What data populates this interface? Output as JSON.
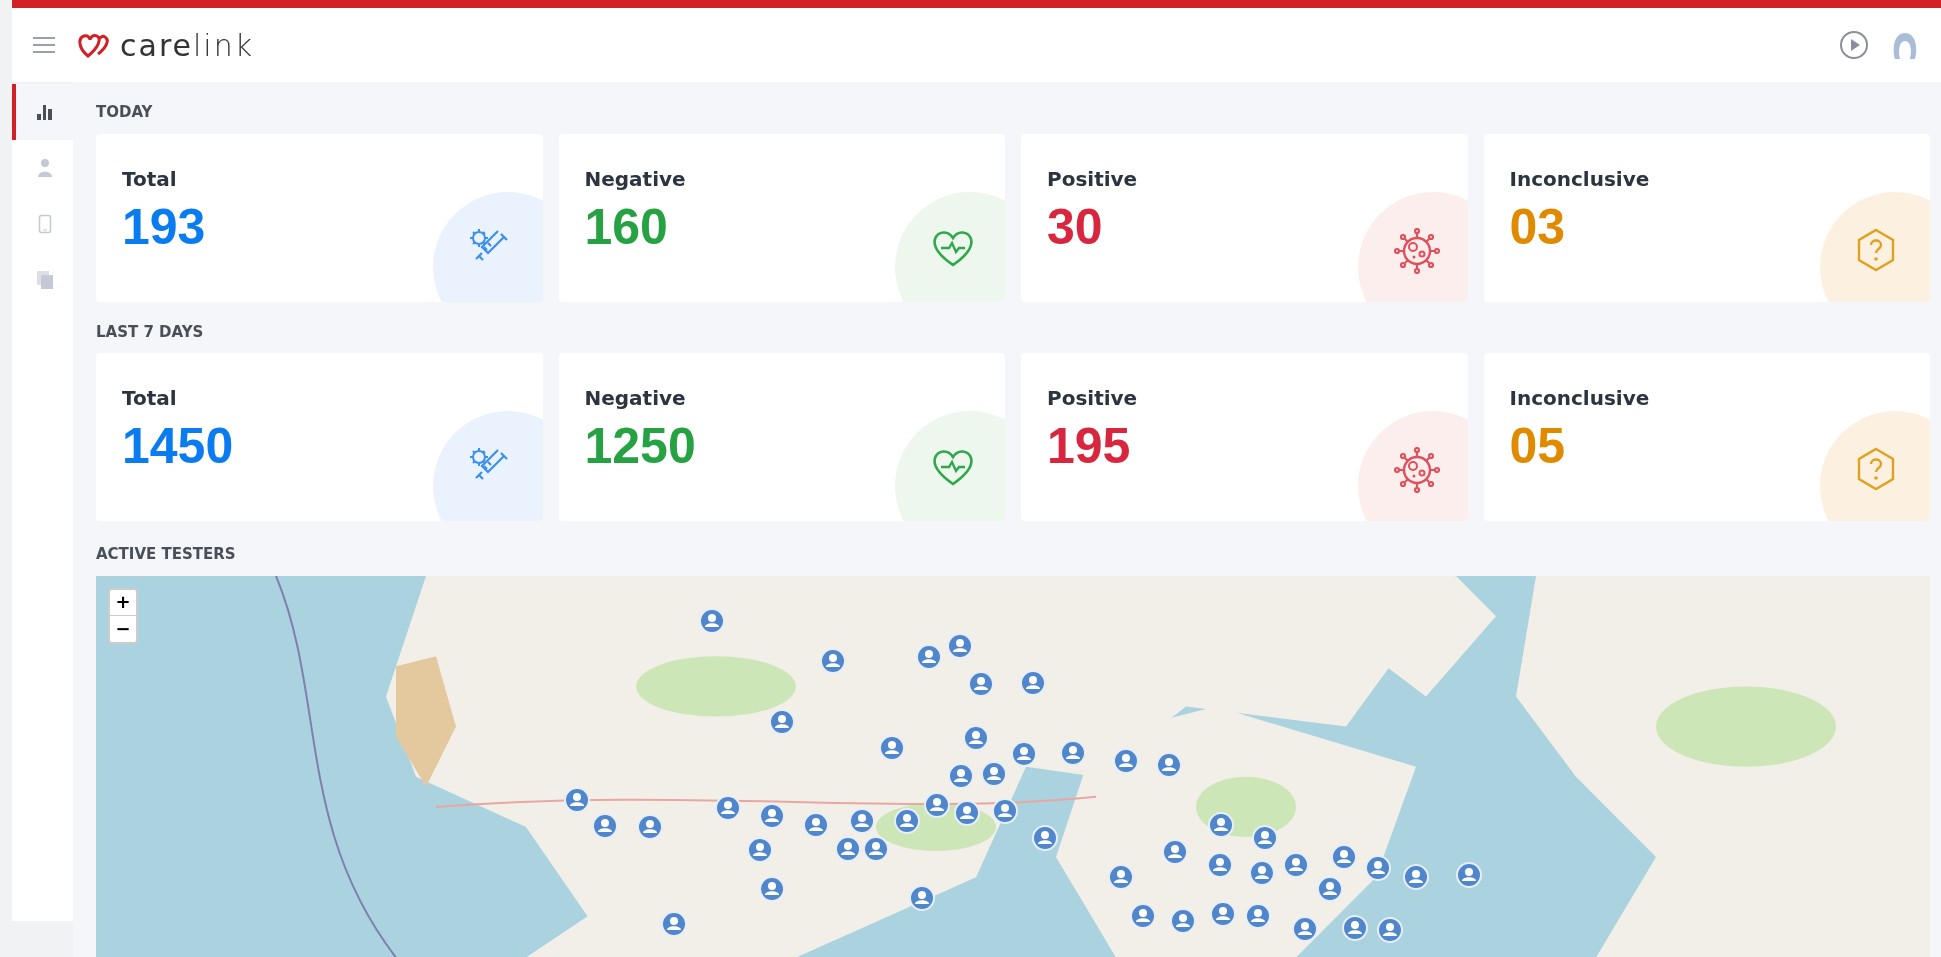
{
  "header": {
    "logo": "**care**link"
  },
  "sidebar": {
    "items": [
      {
        "kind": "chart",
        "selected": true
      },
      {
        "kind": "person",
        "selected": false
      },
      {
        "kind": "phone",
        "selected": false
      },
      {
        "kind": "copy",
        "selected": false
      }
    ]
  },
  "sections": [
    {
      "title": "TODAY",
      "cards": [
        {
          "kind": "total",
          "label": "Total",
          "value": "193"
        },
        {
          "kind": "negative",
          "label": "Negative",
          "value": "160"
        },
        {
          "kind": "positive",
          "label": "Positive",
          "value": "30"
        },
        {
          "kind": "inconclusive",
          "label": "Inconclusive",
          "value": "03"
        }
      ]
    },
    {
      "title": "LAST 7 DAYS",
      "cards": [
        {
          "kind": "total",
          "label": "Total",
          "value": "1450"
        },
        {
          "kind": "negative",
          "label": "Negative",
          "value": "1250"
        },
        {
          "kind": "positive",
          "label": "Positive",
          "value": "195"
        },
        {
          "kind": "inconclusive",
          "label": "Inconclusive",
          "value": "05"
        }
      ]
    }
  ],
  "map": {
    "title": "ACTIVE TESTERS",
    "zoom_in": "+",
    "zoom_out": "−"
  }
}
